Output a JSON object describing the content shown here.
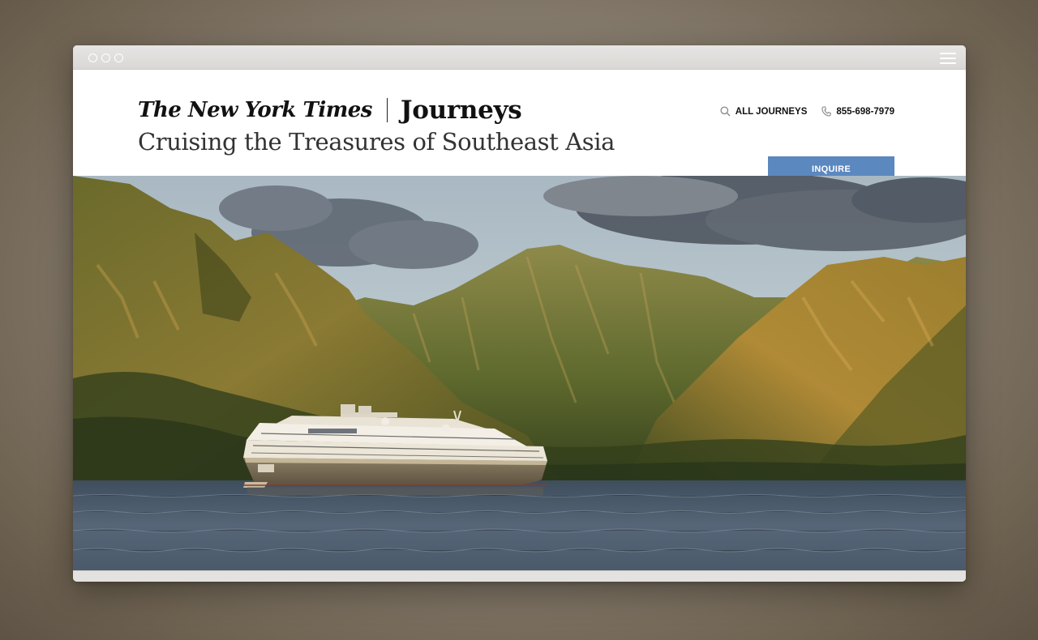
{
  "window": {
    "dots": [
      "close",
      "minimize",
      "maximize"
    ],
    "menu_icon": "hamburger-menu-icon"
  },
  "header": {
    "brand_name": "The New York Times",
    "product_name": "Journeys",
    "subtitle": "Cruising the Treasures of Southeast Asia"
  },
  "nav": {
    "all_journeys_label": "ALL JOURNEYS",
    "all_journeys_icon": "search-icon",
    "phone_label": "855-698-7979",
    "phone_icon": "phone-icon"
  },
  "cta": {
    "inquire_label": "INQUIRE"
  },
  "hero": {
    "image_subject": "cruise ship anchored below green mountains at sunset",
    "colors": {
      "sky": "#b9c7cf",
      "cloud": "#5d6470",
      "mountain_light": "#9a8a3e",
      "mountain_dark": "#3f4a22",
      "water": "#4a5a6a",
      "ship_hull": "#7a6e58",
      "ship_upper": "#efe9dc"
    }
  },
  "theme": {
    "accent": "#5b88bf"
  }
}
